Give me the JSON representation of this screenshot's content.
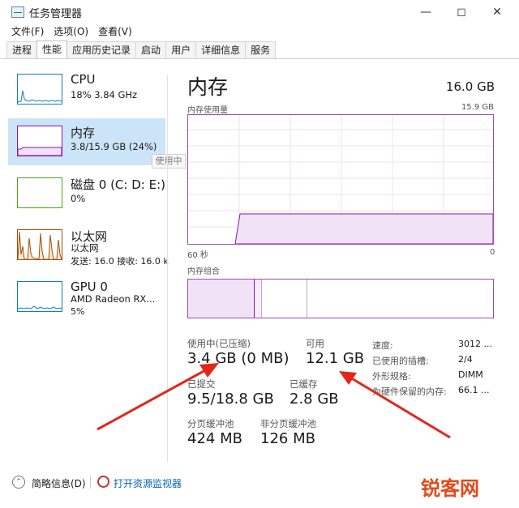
{
  "window": {
    "title": "任务管理器"
  },
  "menu": [
    "文件(F)",
    "选项(O)",
    "查看(V)"
  ],
  "tabs": [
    "进程",
    "性能",
    "应用历史记录",
    "启动",
    "用户",
    "详细信息",
    "服务"
  ],
  "sidebar": [
    {
      "title": "CPU",
      "sub": "18%  3.84 GHz",
      "sub2": "",
      "color": "#117dbb"
    },
    {
      "title": "内存",
      "sub": "3.8/15.9 GB (24%)",
      "sub2": "",
      "color": "#8b12ae"
    },
    {
      "title": "磁盘 0 (C: D: E:)",
      "sub": "0%",
      "sub2": "",
      "color": "#4da60c"
    },
    {
      "title": "以太网",
      "sub": "以太网",
      "sub2": "发送: 16.0  接收: 16.0 k",
      "color": "#a74f01"
    },
    {
      "title": "GPU 0",
      "sub": "AMD Radeon RX...",
      "sub2": "5%",
      "color": "#117dbb"
    }
  ],
  "tooltip": "使用中",
  "main": {
    "title": "内存",
    "total": "16.0 GB",
    "usage_label": "内存使用量",
    "usage_max": "15.9 GB",
    "axis_left": "60 秒",
    "axis_right": "0",
    "composition_label": "内存组合",
    "usage_percent": 24
  },
  "stats": {
    "in_use_label": "使用中(已压缩)",
    "in_use_value": "3.4 GB (0 MB)",
    "available_label": "可用",
    "available_value": "12.1 GB",
    "committed_label": "已提交",
    "committed_value": "9.5/18.8 GB",
    "cached_label": "已缓存",
    "cached_value": "2.8 GB",
    "paged_label": "分页缓冲池",
    "paged_value": "424 MB",
    "nonpaged_label": "非分页缓冲池",
    "nonpaged_value": "126 MB"
  },
  "details": [
    {
      "label": "速度:",
      "value": "3012 ..."
    },
    {
      "label": "已使用的插槽:",
      "value": "2/4"
    },
    {
      "label": "外形规格:",
      "value": "DIMM"
    },
    {
      "label": "为硬件保留的内存:",
      "value": "66.1 ..."
    }
  ],
  "bottom": {
    "fewer_details": "简略信息(D)",
    "open_monitor": "打开资源监视器"
  },
  "watermark": "锐客网"
}
